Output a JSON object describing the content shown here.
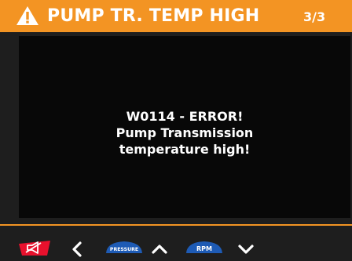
{
  "header": {
    "title": "PUMP TR. TEMP HIGH",
    "page_indicator": "3/3",
    "icon": "warning-triangle-icon",
    "color": "#f39423"
  },
  "message": {
    "lines": [
      "W0114 - ERROR!",
      "Pump Transmission",
      "temperature high!"
    ]
  },
  "toolbar": {
    "pressure_label": "PRESSURE",
    "rpm_label": "RPM",
    "icons": [
      "mute-horn-icon",
      "chevron-left-icon",
      "pressure-gauge-icon",
      "chevron-up-icon",
      "rpm-gauge-icon",
      "chevron-down-icon"
    ],
    "mute_color": "#e8112d",
    "gauge_color": "#1e5bb5"
  }
}
